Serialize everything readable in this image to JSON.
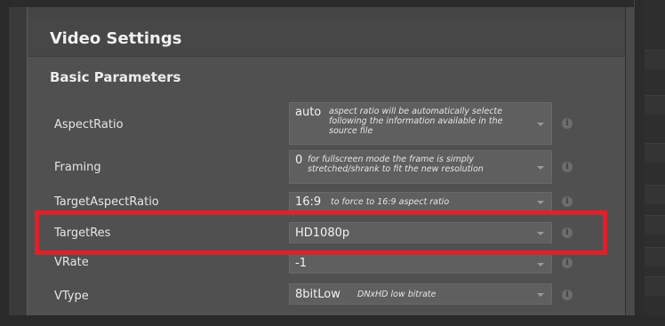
{
  "panel": {
    "title": "Video Settings",
    "section_title": "Basic Parameters"
  },
  "params": [
    {
      "label": "AspectRatio",
      "value": "auto",
      "description": "aspect ratio will be automatically selecte following the information available in the source file"
    },
    {
      "label": "Framing",
      "value": "0",
      "description": "for fullscreen mode the frame is simply stretched/shrank to fit the new resolution"
    },
    {
      "label": "TargetAspectRatio",
      "value": "16:9",
      "description": "to force to 16:9 aspect ratio"
    },
    {
      "label": "TargetRes",
      "value": "HD1080p",
      "description": ""
    },
    {
      "label": "VRate",
      "value": "-1",
      "description": ""
    },
    {
      "label": "VType",
      "value": "8bitLow",
      "description": "DNxHD low bitrate"
    }
  ],
  "icons": {
    "dropdown": "chevron-down-icon",
    "info": "info-icon"
  },
  "info_glyph": "i",
  "colors": {
    "highlight": "#e0202a",
    "panel_bg": "#505050",
    "select_bg": "#5f5f5f"
  }
}
